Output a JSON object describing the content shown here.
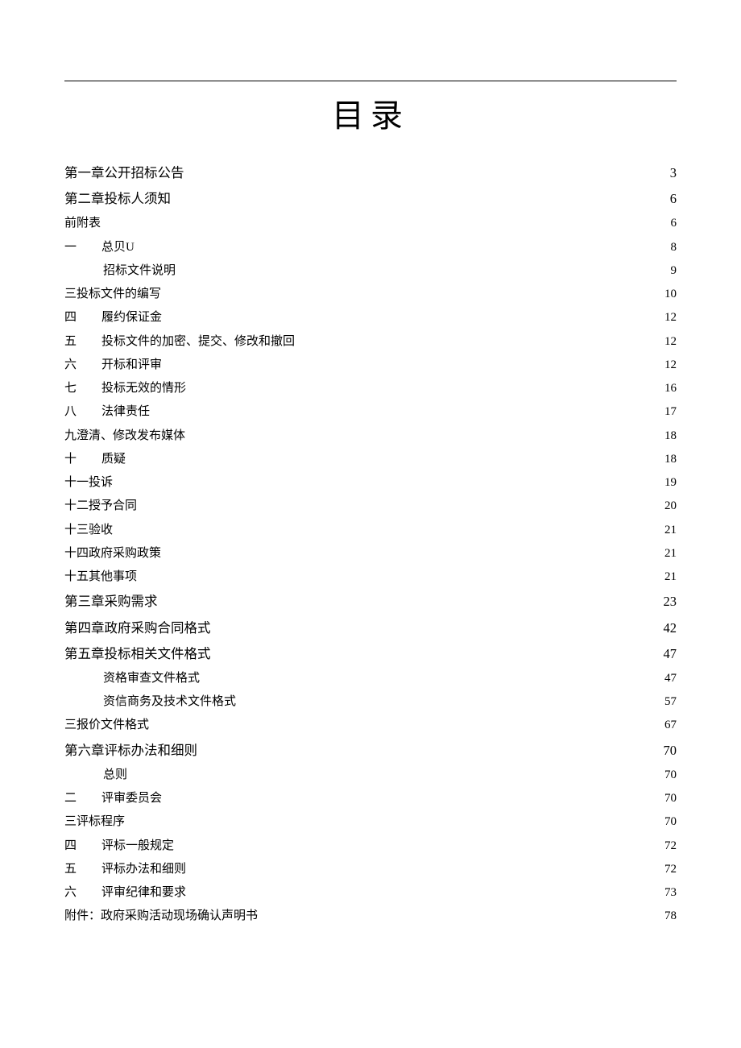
{
  "title": "目录",
  "toc": [
    {
      "level": 1,
      "prefix": "",
      "indent": 0,
      "label": "第一章公开招标公告",
      "page": "3"
    },
    {
      "level": 1,
      "prefix": "",
      "indent": 0,
      "label": "第二章投标人须知",
      "page": "6"
    },
    {
      "level": 2,
      "prefix": "",
      "indent": 0,
      "label": "前附表",
      "page": "6"
    },
    {
      "level": 2,
      "prefix": "一",
      "indent": 1,
      "label": "总贝U",
      "page": "8"
    },
    {
      "level": 3,
      "prefix": "",
      "indent": 2,
      "label": "招标文件说明",
      "page": "9"
    },
    {
      "level": 2,
      "prefix": "",
      "indent": 0,
      "label": "三投标文件的编写",
      "page": "10"
    },
    {
      "level": 2,
      "prefix": "四",
      "indent": 1,
      "label": "履约保证金",
      "page": "12"
    },
    {
      "level": 2,
      "prefix": "五",
      "indent": 1,
      "label": "投标文件的加密、提交、修改和撤回",
      "page": "12"
    },
    {
      "level": 2,
      "prefix": "六",
      "indent": 1,
      "label": "开标和评审",
      "page": "12"
    },
    {
      "level": 2,
      "prefix": "七",
      "indent": 1,
      "label": "投标无效的情形",
      "page": "16"
    },
    {
      "level": 2,
      "prefix": "八",
      "indent": 1,
      "label": "法律责任",
      "page": "17"
    },
    {
      "level": 2,
      "prefix": "",
      "indent": 0,
      "label": "九澄清、修改发布媒体",
      "page": "18"
    },
    {
      "level": 2,
      "prefix": "十",
      "indent": 1,
      "label": "质疑",
      "page": "18"
    },
    {
      "level": 2,
      "prefix": "",
      "indent": 0,
      "label": "十一投诉",
      "page": "19"
    },
    {
      "level": 2,
      "prefix": "",
      "indent": 0,
      "label": "十二授予合同",
      "page": "20"
    },
    {
      "level": 2,
      "prefix": "",
      "indent": 0,
      "label": "十三验收",
      "page": "21"
    },
    {
      "level": 2,
      "prefix": "",
      "indent": 0,
      "label": "十四政府采购政策",
      "page": "21"
    },
    {
      "level": 2,
      "prefix": "",
      "indent": 0,
      "label": "十五其他事项",
      "page": "21"
    },
    {
      "level": 1,
      "prefix": "",
      "indent": 0,
      "label": "第三章采购需求",
      "page": "23"
    },
    {
      "level": 1,
      "prefix": "",
      "indent": 0,
      "label": "第四章政府采购合同格式",
      "page": "42"
    },
    {
      "level": 1,
      "prefix": "",
      "indent": 0,
      "label": "第五章投标相关文件格式",
      "page": "47"
    },
    {
      "level": 3,
      "prefix": "",
      "indent": 2,
      "label": "资格审查文件格式",
      "page": "47"
    },
    {
      "level": 3,
      "prefix": "",
      "indent": 2,
      "label": "资信商务及技术文件格式",
      "page": "57"
    },
    {
      "level": 2,
      "prefix": "",
      "indent": 0,
      "label": "三报价文件格式",
      "page": "67"
    },
    {
      "level": 1,
      "prefix": "",
      "indent": 0,
      "label": "第六章评标办法和细则",
      "page": "70"
    },
    {
      "level": 3,
      "prefix": "",
      "indent": 2,
      "label": "总则",
      "page": "70"
    },
    {
      "level": 2,
      "prefix": "二",
      "indent": 1,
      "label": "评审委员会",
      "page": "70"
    },
    {
      "level": 2,
      "prefix": "",
      "indent": 0,
      "label": "三评标程序",
      "page": "70"
    },
    {
      "level": 2,
      "prefix": "四",
      "indent": 1,
      "label": "评标一般规定",
      "page": "72"
    },
    {
      "level": 2,
      "prefix": "五",
      "indent": 1,
      "label": "评标办法和细则",
      "page": "72"
    },
    {
      "level": 2,
      "prefix": "六",
      "indent": 1,
      "label": "评审纪律和要求",
      "page": "73"
    },
    {
      "level": 2,
      "prefix": "",
      "indent": 0,
      "label": "附件：政府采购活动现场确认声明书",
      "page": "78"
    }
  ]
}
